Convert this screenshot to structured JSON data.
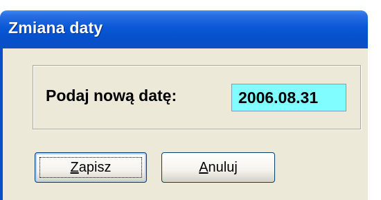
{
  "window": {
    "title": "Zmiana daty"
  },
  "form": {
    "date_label": "Podaj nową datę:",
    "date_value": "2006.08.31"
  },
  "buttons": {
    "save": {
      "accel": "Z",
      "rest": "apisz"
    },
    "cancel": {
      "accel": "A",
      "rest": "nuluj"
    }
  },
  "colors": {
    "title_bar": "#0a58d6",
    "input_background": "#7ffdff",
    "dialog_background": "#ece9d8"
  }
}
